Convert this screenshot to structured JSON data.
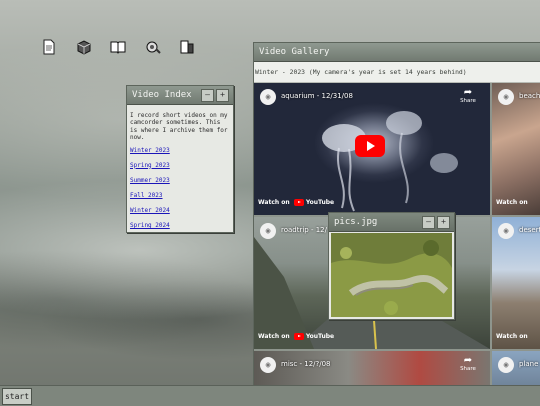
{
  "desktop": {
    "icons": [
      "document-icon",
      "package-icon",
      "book-icon",
      "settings-icon",
      "folder-icon"
    ]
  },
  "index_window": {
    "title": "Video Index",
    "description": "I record short videos on my camcorder sometimes. This is where I archive them for now.",
    "links": [
      "Winter 2023",
      "Spring 2023",
      "Summer 2023",
      "Fall 2023",
      "Winter 2024",
      "Spring 2024"
    ]
  },
  "gallery_window": {
    "title": "Video Gallery",
    "breadcrumb": "Winter - 2023 (My camera's year is set 14 years behind)",
    "share_label": "Share",
    "watch_on": "Watch on",
    "youtube": "YouTube",
    "videos": [
      {
        "title": "aquarium - 12/31/08"
      },
      {
        "title": "beach"
      },
      {
        "title": "roadtrip - 12/"
      },
      {
        "title": "desert"
      },
      {
        "title": "misc - 12/?/08"
      },
      {
        "title": "plane -"
      }
    ]
  },
  "pics_window": {
    "title": "pics.jpg"
  },
  "taskbar": {
    "start_label": "start"
  }
}
